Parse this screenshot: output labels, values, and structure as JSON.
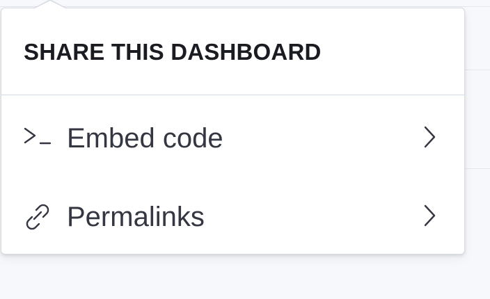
{
  "popover": {
    "title": "SHARE THIS DASHBOARD",
    "items": [
      {
        "label": "Embed code",
        "icon": "console-icon",
        "trailing_icon": "chevron-right-icon"
      },
      {
        "label": "Permalinks",
        "icon": "link-icon",
        "trailing_icon": "chevron-right-icon"
      }
    ]
  },
  "colors": {
    "title": "#1a1c21",
    "item_text": "#343741",
    "icon": "#343741",
    "border": "#d7dbe3"
  }
}
